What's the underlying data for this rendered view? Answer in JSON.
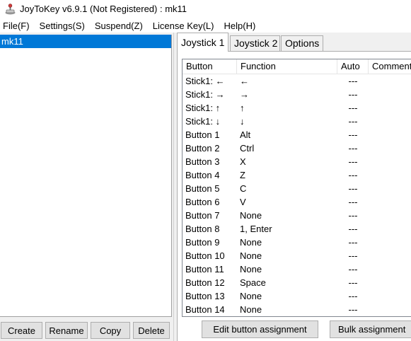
{
  "window": {
    "title": "JoyToKey v6.9.1 (Not Registered) : mk11",
    "icon": "joystick-app-icon"
  },
  "menu": [
    {
      "label": "File(F)"
    },
    {
      "label": "Settings(S)"
    },
    {
      "label": "Suspend(Z)"
    },
    {
      "label": "License Key(L)"
    },
    {
      "label": "Help(H)"
    }
  ],
  "config_list": {
    "items": [
      {
        "label": "mk11",
        "selected": true
      }
    ]
  },
  "config_buttons": {
    "create": "Create",
    "rename": "Rename",
    "copy": "Copy",
    "delete": "Delete"
  },
  "tabs": [
    {
      "label": "Joystick 1",
      "active": true
    },
    {
      "label": "Joystick 2",
      "active": false
    },
    {
      "label": "Options",
      "active": false
    }
  ],
  "table": {
    "columns": [
      "Button",
      "Function",
      "Auto",
      "Comment"
    ],
    "rows": [
      {
        "button": "Stick1: ←",
        "function": "←",
        "auto": "---"
      },
      {
        "button": "Stick1: →",
        "function": "→",
        "auto": "---"
      },
      {
        "button": "Stick1: ↑",
        "function": "↑",
        "auto": "---"
      },
      {
        "button": "Stick1: ↓",
        "function": "↓",
        "auto": "---"
      },
      {
        "button": "Button 1",
        "function": "Alt",
        "auto": "---"
      },
      {
        "button": "Button 2",
        "function": "Ctrl",
        "auto": "---"
      },
      {
        "button": "Button 3",
        "function": "X",
        "auto": "---"
      },
      {
        "button": "Button 4",
        "function": "Z",
        "auto": "---"
      },
      {
        "button": "Button 5",
        "function": "C",
        "auto": "---"
      },
      {
        "button": "Button 6",
        "function": "V",
        "auto": "---"
      },
      {
        "button": "Button 7",
        "function": "None",
        "auto": "---"
      },
      {
        "button": "Button 8",
        "function": "1, Enter",
        "auto": "---"
      },
      {
        "button": "Button 9",
        "function": "None",
        "auto": "---"
      },
      {
        "button": "Button 10",
        "function": "None",
        "auto": "---"
      },
      {
        "button": "Button 11",
        "function": "None",
        "auto": "---"
      },
      {
        "button": "Button 12",
        "function": "Space",
        "auto": "---"
      },
      {
        "button": "Button 13",
        "function": "None",
        "auto": "---"
      },
      {
        "button": "Button 14",
        "function": "None",
        "auto": "---"
      }
    ]
  },
  "actions": {
    "edit": "Edit button assignment",
    "bulk": "Bulk assignment"
  },
  "colors": {
    "selection": "#0078d7",
    "button_face": "#e1e1e1",
    "window_bg": "#f0f0f0"
  }
}
